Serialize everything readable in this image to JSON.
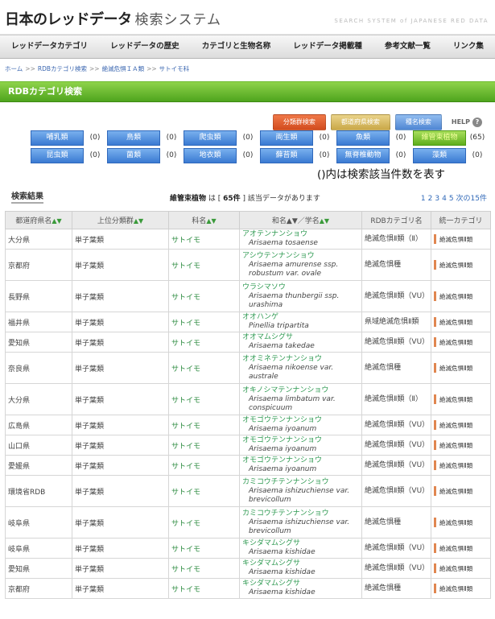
{
  "header": {
    "title": "日本のレッドデータ",
    "subtitle": "検索システム",
    "english": "SEARCH SYSTEM of JAPANESE RED DATA"
  },
  "nav": [
    "レッドデータカテゴリ",
    "レッドデータの歴史",
    "カテゴリと生物名称",
    "レッドデータ掲載種",
    "参考文献一覧",
    "リンク集"
  ],
  "breadcrumb": [
    "ホーム",
    "RDBカテゴリ検索",
    "絶滅危惧ＩＡ類",
    "サトイモ科"
  ],
  "section_title": "RDBカテゴリ検索",
  "search_buttons": {
    "group": "分類群検索",
    "area": "都道府県検索",
    "name": "種名検索",
    "help": "HELP"
  },
  "category_rows": [
    [
      {
        "label": "哺乳類",
        "count": "(0)"
      },
      {
        "label": "鳥類",
        "count": "(0)"
      },
      {
        "label": "爬虫類",
        "count": "(0)"
      },
      {
        "label": "両生類",
        "count": "(0)"
      },
      {
        "label": "魚類",
        "count": "(0)"
      },
      {
        "label": "維管束植物",
        "count": "(65)",
        "active": true
      }
    ],
    [
      {
        "label": "昆虫類",
        "count": "(0)"
      },
      {
        "label": "菌類",
        "count": "(0)"
      },
      {
        "label": "地衣類",
        "count": "(0)"
      },
      {
        "label": "蘚苔類",
        "count": "(0)"
      },
      {
        "label": "無脊椎動物",
        "count": "(0)"
      },
      {
        "label": "藻類",
        "count": "(0)"
      }
    ]
  ],
  "note": "()内は検索該当件数を表す",
  "results": {
    "title": "検索結果",
    "summary_group": "維管束植物",
    "summary_pre": " は [ ",
    "summary_count": "65件",
    "summary_post": " ] 該当データがあります",
    "pages": [
      "1",
      "2",
      "3",
      "4",
      "5"
    ],
    "next": "次の15件"
  },
  "table": {
    "headers": [
      "都道府県名",
      "上位分類群",
      "科名",
      "和名▲▼／学名",
      "RDBカテゴリ名",
      "統一カテゴリ"
    ],
    "rows": [
      {
        "pref": "大分県",
        "group": "単子葉類",
        "family": "サトイモ",
        "jname": "アオテンナンショウ",
        "sci": "Arisaema tosaense",
        "cat": "絶滅危惧Ⅱ類（Ⅱ）",
        "unified": "絶滅危惧Ⅱ類"
      },
      {
        "pref": "京都府",
        "group": "単子葉類",
        "family": "サトイモ",
        "jname": "アシウテンナンショウ",
        "sci": "Arisaema amurense ssp. robustum var. ovale",
        "cat": "絶滅危惧種",
        "unified": "絶滅危惧Ⅱ類"
      },
      {
        "pref": "長野県",
        "group": "単子葉類",
        "family": "サトイモ",
        "jname": "ウラシマソウ",
        "sci": "Arisaema thunbergii ssp. urashima",
        "cat": "絶滅危惧Ⅱ類（VU）",
        "unified": "絶滅危惧Ⅱ類"
      },
      {
        "pref": "福井県",
        "group": "単子葉類",
        "family": "サトイモ",
        "jname": "オオハンゲ",
        "sci": "Pinellia tripartita",
        "cat": "県域絶滅危惧Ⅱ類",
        "unified": "絶滅危惧Ⅱ類"
      },
      {
        "pref": "愛知県",
        "group": "単子葉類",
        "family": "サトイモ",
        "jname": "オオマムシグサ",
        "sci": "Arisaema takedae",
        "cat": "絶滅危惧Ⅱ類（VU）",
        "unified": "絶滅危惧Ⅱ類"
      },
      {
        "pref": "奈良県",
        "group": "単子葉類",
        "family": "サトイモ",
        "jname": "オオミネテンナンショウ",
        "sci": "Arisaema nikoense var. australe",
        "cat": "絶滅危惧種",
        "unified": "絶滅危惧Ⅱ類"
      },
      {
        "pref": "大分県",
        "group": "単子葉類",
        "family": "サトイモ",
        "jname": "オキノシマテンナンショウ",
        "sci": "Arisaema limbatum var. conspicuum",
        "cat": "絶滅危惧Ⅱ類（Ⅱ）",
        "unified": "絶滅危惧Ⅱ類"
      },
      {
        "pref": "広島県",
        "group": "単子葉類",
        "family": "サトイモ",
        "jname": "オモゴウテンナンショウ",
        "sci": "Arisaema iyoanum",
        "cat": "絶滅危惧Ⅱ類（VU）",
        "unified": "絶滅危惧Ⅱ類"
      },
      {
        "pref": "山口県",
        "group": "単子葉類",
        "family": "サトイモ",
        "jname": "オモゴウテンナンショウ",
        "sci": "Arisaema iyoanum",
        "cat": "絶滅危惧Ⅱ類（VU）",
        "unified": "絶滅危惧Ⅱ類"
      },
      {
        "pref": "愛媛県",
        "group": "単子葉類",
        "family": "サトイモ",
        "jname": "オモゴウテンナンショウ",
        "sci": "Arisaema iyoanum",
        "cat": "絶滅危惧Ⅱ類（VU）",
        "unified": "絶滅危惧Ⅱ類"
      },
      {
        "pref": "環境省RDB",
        "group": "単子葉類",
        "family": "サトイモ",
        "jname": "カミコウチテンナンショウ",
        "sci": "Arisaema ishizuchiense var. brevicollum",
        "cat": "絶滅危惧Ⅱ類（VU）",
        "unified": "絶滅危惧Ⅱ類"
      },
      {
        "pref": "岐阜県",
        "group": "単子葉類",
        "family": "サトイモ",
        "jname": "カミコウチテンナンショウ",
        "sci": "Arisaema ishizuchiense var. brevicollum",
        "cat": "絶滅危惧種",
        "unified": "絶滅危惧Ⅱ類"
      },
      {
        "pref": "岐阜県",
        "group": "単子葉類",
        "family": "サトイモ",
        "jname": "キシダマムシグサ",
        "sci": "Arisaema kishidae",
        "cat": "絶滅危惧Ⅱ類（VU）",
        "unified": "絶滅危惧Ⅱ類"
      },
      {
        "pref": "愛知県",
        "group": "単子葉類",
        "family": "サトイモ",
        "jname": "キシダマムシグサ",
        "sci": "Arisaema kishidae",
        "cat": "絶滅危惧Ⅱ類（VU）",
        "unified": "絶滅危惧Ⅱ類"
      },
      {
        "pref": "京都府",
        "group": "単子葉類",
        "family": "サトイモ",
        "jname": "キシダマムシグサ",
        "sci": "Arisaema kishidae",
        "cat": "絶滅危惧種",
        "unified": "絶滅危惧Ⅱ類"
      }
    ]
  }
}
